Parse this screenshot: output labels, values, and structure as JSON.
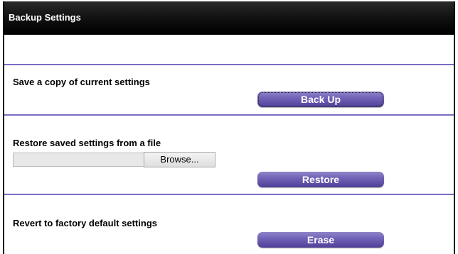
{
  "header": {
    "title": "Backup Settings"
  },
  "backup": {
    "label": "Save a copy of current settings",
    "button": "Back Up"
  },
  "restore": {
    "label": "Restore saved settings from a file",
    "browse_button": "Browse...",
    "button": "Restore"
  },
  "erase": {
    "label": "Revert to factory default settings",
    "button": "Erase"
  },
  "colors": {
    "accent": "#6f5fb5",
    "divider": "#7a6cc4",
    "header_bg": "#111111"
  }
}
